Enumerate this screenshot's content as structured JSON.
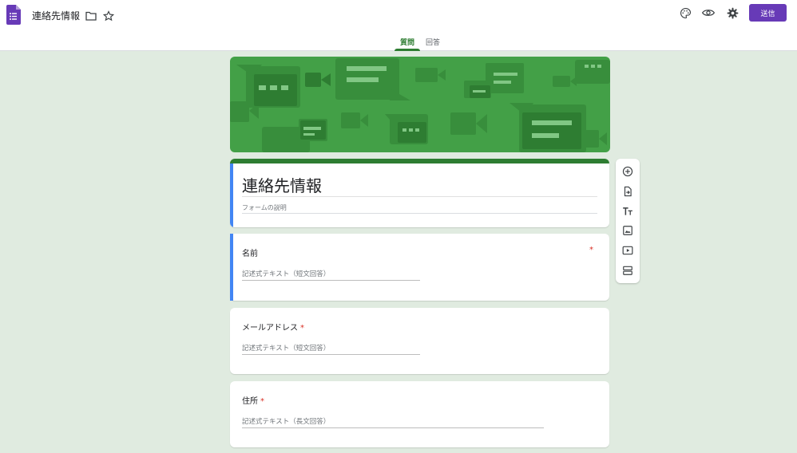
{
  "header": {
    "title": "連絡先情報",
    "send_label": "送信",
    "icons": [
      "forms-logo-icon",
      "folder-icon",
      "star-icon",
      "palette-icon",
      "preview-eye-icon",
      "settings-gear-icon"
    ]
  },
  "tabs": [
    {
      "label": "質問",
      "active": true
    },
    {
      "label": "回答",
      "active": false
    }
  ],
  "form": {
    "title": "連絡先情報",
    "description_placeholder": "フォームの説明"
  },
  "questions": [
    {
      "title": "名前",
      "required_mark": "*",
      "placeholder": "記述式テキスト（短文回答）"
    },
    {
      "title": "メールアドレス",
      "required_mark": "*",
      "placeholder": "記述式テキスト（短文回答）"
    },
    {
      "title": "住所",
      "required_mark": "*",
      "placeholder": "記述式テキスト（長文回答）"
    }
  ],
  "toolbar": [
    "add-question-icon",
    "import-questions-icon",
    "add-title-icon",
    "add-image-icon",
    "add-video-icon",
    "add-section-icon"
  ],
  "colors": {
    "accent_purple": "#673ab7",
    "theme_green": "#2e7d32",
    "banner_green": "#43a047",
    "active_card_blue": "#4285f4",
    "page_background": "#e0ebe0",
    "required_red": "#d93025"
  }
}
